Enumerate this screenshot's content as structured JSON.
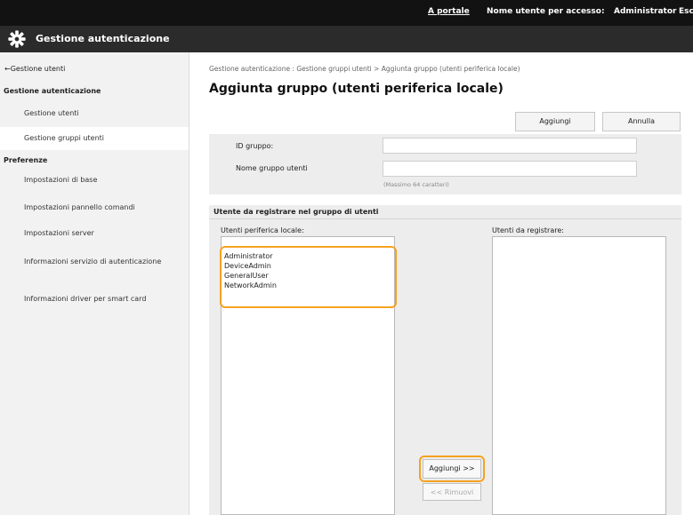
{
  "topbar": {
    "portal": "A portale",
    "user_label": "Nome utente per accesso:",
    "user": "Administrator",
    "exit": "Esc"
  },
  "titlebar": {
    "title": "Gestione autenticazione",
    "icon": "gear-icon"
  },
  "sidebar": {
    "back_link": "←Gestione utenti",
    "section1": "Gestione autenticazione",
    "item_users": "Gestione utenti",
    "item_groups": "Gestione gruppi utenti",
    "section2": "Preferenze",
    "pref_basic": "Impostazioni di base",
    "pref_panel": "Impostazioni pannello comandi",
    "pref_server": "Impostazioni server",
    "info_service": "Informazioni servizio di autenticazione",
    "info_driver": "Informazioni driver per smart card"
  },
  "main": {
    "breadcrumb": "Gestione autenticazione : Gestione gruppi utenti > Aggiunta gruppo (utenti periferica locale)",
    "title": "Aggiunta gruppo (utenti periferica locale)",
    "add_button": "Aggiungi",
    "cancel_button": "Annulla",
    "form": {
      "group_id_label": "ID gruppo:",
      "group_id_value": "",
      "group_name_label": "Nome gruppo utenti",
      "group_name_value": "",
      "hint": "(Massimo 64 caratteri)"
    },
    "register": {
      "heading": "Utente da registrare nel gruppo di utenti",
      "left_header": "Utenti periferica locale:",
      "right_header": "Utenti da registrare:",
      "left_items": [
        "Administrator",
        "DeviceAdmin",
        "GeneralUser",
        "NetworkAdmin"
      ],
      "right_items": [],
      "add_move": "Aggiungi >>",
      "remove_move": "<< Rimuovi"
    }
  },
  "colors": {
    "highlight": "#f5a220",
    "topbar": "#121212",
    "titlebar": "#2b2b2b"
  }
}
